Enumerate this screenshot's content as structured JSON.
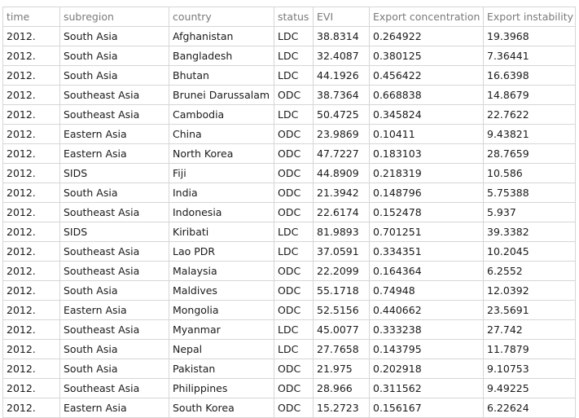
{
  "table": {
    "columns": [
      "time",
      "subregion",
      "country",
      "status",
      "EVI",
      "Export concentration",
      "Export instability"
    ],
    "rows": [
      [
        "2012.",
        "South Asia",
        "Afghanistan",
        "LDC",
        "38.8314",
        "0.264922",
        "19.3968"
      ],
      [
        "2012.",
        "South Asia",
        "Bangladesh",
        "LDC",
        "32.4087",
        "0.380125",
        "7.36441"
      ],
      [
        "2012.",
        "South Asia",
        "Bhutan",
        "LDC",
        "44.1926",
        "0.456422",
        "16.6398"
      ],
      [
        "2012.",
        "Southeast Asia",
        "Brunei Darussalam",
        "ODC",
        "38.7364",
        "0.668838",
        "14.8679"
      ],
      [
        "2012.",
        "Southeast Asia",
        "Cambodia",
        "LDC",
        "50.4725",
        "0.345824",
        "22.7622"
      ],
      [
        "2012.",
        "Eastern Asia",
        "China",
        "ODC",
        "23.9869",
        "0.10411",
        "9.43821"
      ],
      [
        "2012.",
        "Eastern Asia",
        "North Korea",
        "ODC",
        "47.7227",
        "0.183103",
        "28.7659"
      ],
      [
        "2012.",
        "SIDS",
        "Fiji",
        "ODC",
        "44.8909",
        "0.218319",
        "10.586"
      ],
      [
        "2012.",
        "South Asia",
        "India",
        "ODC",
        "21.3942",
        "0.148796",
        "5.75388"
      ],
      [
        "2012.",
        "Southeast Asia",
        "Indonesia",
        "ODC",
        "22.6174",
        "0.152478",
        "5.937"
      ],
      [
        "2012.",
        "SIDS",
        "Kiribati",
        "LDC",
        "81.9893",
        "0.701251",
        "39.3382"
      ],
      [
        "2012.",
        "Southeast Asia",
        "Lao PDR",
        "LDC",
        "37.0591",
        "0.334351",
        "10.2045"
      ],
      [
        "2012.",
        "Southeast Asia",
        "Malaysia",
        "ODC",
        "22.2099",
        "0.164364",
        "6.2552"
      ],
      [
        "2012.",
        "South Asia",
        "Maldives",
        "ODC",
        "55.1718",
        "0.74948",
        "12.0392"
      ],
      [
        "2012.",
        "Eastern Asia",
        "Mongolia",
        "ODC",
        "52.5156",
        "0.440662",
        "23.5691"
      ],
      [
        "2012.",
        "Southeast Asia",
        "Myanmar",
        "LDC",
        "45.0077",
        "0.333238",
        "27.742"
      ],
      [
        "2012.",
        "South Asia",
        "Nepal",
        "LDC",
        "27.7658",
        "0.143795",
        "11.7879"
      ],
      [
        "2012.",
        "South Asia",
        "Pakistan",
        "ODC",
        "21.975",
        "0.202918",
        "9.10753"
      ],
      [
        "2012.",
        "Southeast Asia",
        "Philippines",
        "ODC",
        "28.966",
        "0.311562",
        "9.49225"
      ],
      [
        "2012.",
        "Eastern Asia",
        "South Korea",
        "ODC",
        "15.2723",
        "0.156167",
        "6.22624"
      ]
    ]
  }
}
